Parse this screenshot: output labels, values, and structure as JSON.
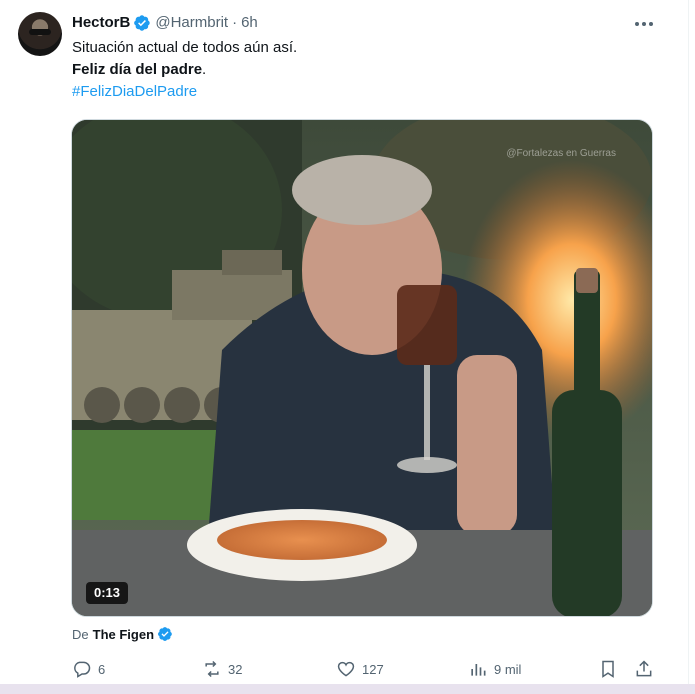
{
  "author": {
    "name": "HectorB",
    "handle": "@Harmbrit",
    "separator": "·",
    "time": "6h"
  },
  "tweet": {
    "line1": "Situación actual de todos aún así.",
    "line2_bold": "Feliz día del padre",
    "line2_suffix": ".",
    "hashtag": "#FelizDiaDelPadre"
  },
  "media": {
    "duration": "0:13",
    "watermark": "@Fortalezas en Guerras"
  },
  "source": {
    "prefix": "De",
    "name": "The Figen"
  },
  "actions": {
    "replies": "6",
    "reposts": "32",
    "likes": "127",
    "views": "9 mil"
  },
  "icons": {
    "verified": "verified-badge-icon",
    "more": "more-options-icon",
    "reply": "reply-icon",
    "repost": "repost-icon",
    "like": "heart-icon",
    "views": "views-icon",
    "bookmark": "bookmark-icon",
    "share": "share-icon"
  },
  "colors": {
    "accent": "#1d9bf0",
    "text": "#0f1419",
    "muted": "#536471"
  }
}
